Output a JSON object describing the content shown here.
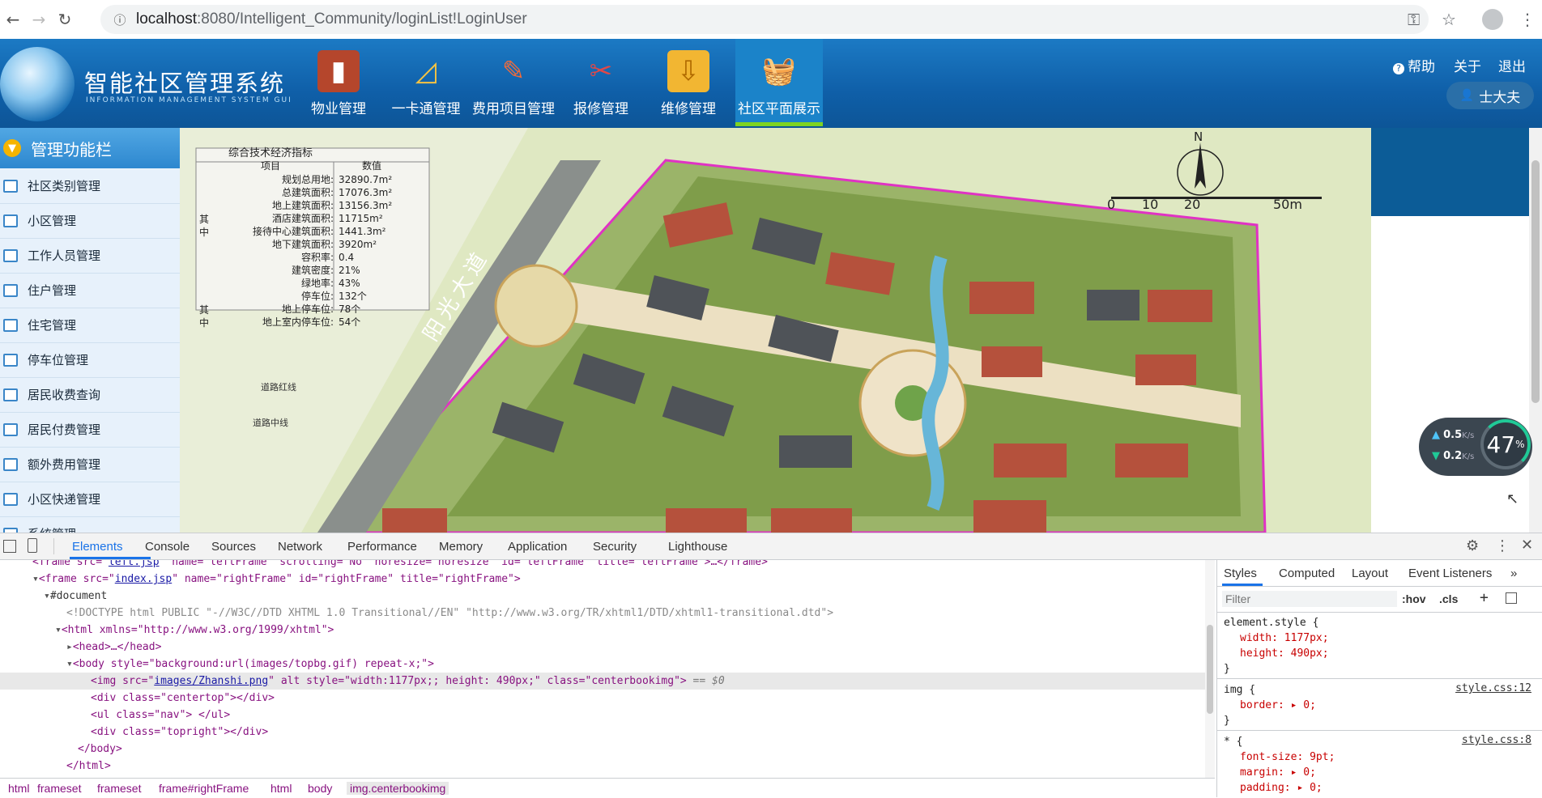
{
  "browser": {
    "url_host": "localhost",
    "url_path": ":8080/Intelligent_Community/loginList!LoginUser"
  },
  "app": {
    "title": "智能社区管理系统",
    "subtitle": "INFORMATION MANAGEMENT SYSTEM GUI",
    "menu": [
      {
        "label": "物业管理",
        "icon": "book-icon"
      },
      {
        "label": "一卡通管理",
        "icon": "ruler-triangle-icon"
      },
      {
        "label": "费用项目管理",
        "icon": "pencil-ruler-icon"
      },
      {
        "label": "报修管理",
        "icon": "tools-icon"
      },
      {
        "label": "维修管理",
        "icon": "folder-download-icon"
      },
      {
        "label": "社区平面展示",
        "icon": "basket-icon"
      }
    ],
    "active_menu": "社区平面展示",
    "top_links": {
      "help": "帮助",
      "about": "关于",
      "logout": "退出"
    },
    "user": "士大夫"
  },
  "sidebar": {
    "header": "管理功能栏",
    "items": [
      {
        "label": "社区类别管理"
      },
      {
        "label": "小区管理"
      },
      {
        "label": "工作人员管理"
      },
      {
        "label": "住户管理"
      },
      {
        "label": "住宅管理"
      },
      {
        "label": "停车位管理"
      },
      {
        "label": "居民收费查询"
      },
      {
        "label": "居民付费管理"
      },
      {
        "label": "额外费用管理"
      },
      {
        "label": "小区快递管理"
      },
      {
        "label": "系统管理"
      }
    ]
  },
  "map": {
    "table_title": "综合技术经济指标",
    "col_item": "项目",
    "col_value": "数值",
    "rows": [
      {
        "item": "规划总用地:",
        "value": "32890.7m²"
      },
      {
        "item": "总建筑面积:",
        "value": "17076.3m²"
      },
      {
        "item": "地上建筑面积:",
        "value": "13156.3m²"
      },
      {
        "item": "酒店建筑面积:",
        "value": "11715m²"
      },
      {
        "item": "接待中心建筑面积:",
        "value": "1441.3m²"
      },
      {
        "item": "地下建筑面积:",
        "value": "3920m²"
      },
      {
        "item": "容积率:",
        "value": "0.4"
      },
      {
        "item": "建筑密度:",
        "value": "21%"
      },
      {
        "item": "绿地率:",
        "value": "43%"
      },
      {
        "item": "停车位:",
        "value": "132个"
      },
      {
        "item": "地上停车位:",
        "value": "78个"
      },
      {
        "item": "地上室内停车位:",
        "value": "54个"
      }
    ],
    "side_marks": [
      "其",
      "中",
      "其",
      "中"
    ],
    "road_name": "阳光大道",
    "road_red_line": "道路红线",
    "road_center_line": "道路中线",
    "north": "N",
    "scale": [
      "0",
      "10",
      "20",
      "50m"
    ]
  },
  "speed_widget": {
    "up": "0.5",
    "down": "0.2",
    "unit": "K/s",
    "percent": "47",
    "percent_sign": "%"
  },
  "devtools": {
    "tabs": [
      "Elements",
      "Console",
      "Sources",
      "Network",
      "Performance",
      "Memory",
      "Application",
      "Security",
      "Lighthouse"
    ],
    "active_tab": "Elements",
    "dom": {
      "l0_a": "<frame src=\"",
      "l0_link": "left.jsp",
      "l0_b": "\" name=\"leftFrame\" scrolling=\"No\" noresize=\"noresize\" id=\"leftFrame\" title=\"leftFrame\">…</frame>",
      "l1_a": "<frame src=\"",
      "l1_link": "index.jsp",
      "l1_b": "\" name=\"rightFrame\" id=\"rightFrame\" title=\"rightFrame\">",
      "l2": "#document",
      "l3": "<!DOCTYPE html PUBLIC \"-//W3C//DTD XHTML 1.0 Transitional//EN\" \"http://www.w3.org/TR/xhtml1/DTD/xhtml1-transitional.dtd\">",
      "l4": "<html xmlns=\"http://www.w3.org/1999/xhtml\">",
      "l5": "<head>…</head>",
      "l6": "<body style=\"background:url(images/topbg.gif) repeat-x;\">",
      "l7_a": "<img src=\"",
      "l7_link": "images/Zhanshi.png",
      "l7_b": "\" alt style=\"width:1177px;; height: 490px;\" class=\"centerbookimg\">",
      "l7_c": " == $0",
      "l8": "<div class=\"centertop\"></div>",
      "l9": "<ul class=\"nav\"> </ul>",
      "l10": "<div class=\"topright\"></div>",
      "l11": "</body>",
      "l12": "</html>"
    },
    "breadcrumb": [
      "html",
      "frameset",
      "frameset",
      "frame#rightFrame",
      "html",
      "body",
      "img.centerbookimg"
    ],
    "styles_tabs": [
      "Styles",
      "Computed",
      "Layout",
      "Event Listeners"
    ],
    "filter_placeholder": "Filter",
    "hov": ":hov",
    "cls": ".cls",
    "rules": {
      "r1_sel": "element.style {",
      "r1_p1": "width: 1177px;",
      "r1_p2": "height: 490px;",
      "r2_sel": "img {",
      "r2_src": "style.css:12",
      "r2_p1": "border: ▸ 0;",
      "r3_sel": "* {",
      "r3_src": "style.css:8",
      "r3_p1": "font-size: 9pt;",
      "r3_p2": "margin: ▸ 0;",
      "r3_p3": "padding: ▸ 0;"
    }
  },
  "colors": {
    "header_blue": "#0f5fa8",
    "active_green": "#7ed321",
    "devtools_blue": "#1a73e8"
  }
}
